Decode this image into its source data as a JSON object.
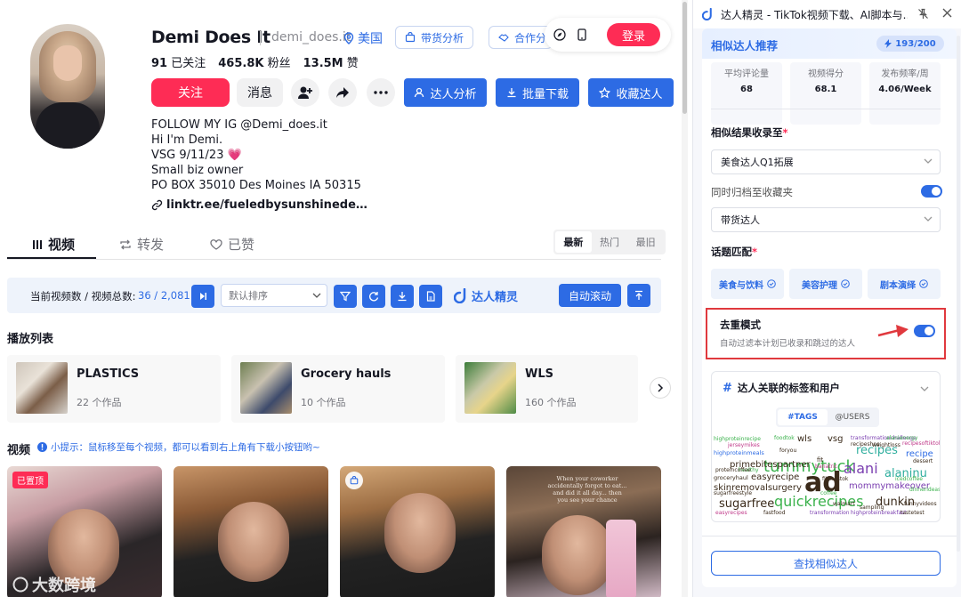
{
  "profile": {
    "name": "Demi Does It",
    "handle": "demi_does.it",
    "country": "美国",
    "following_count": "91",
    "following_label": "已关注",
    "followers_count": "465.8K",
    "followers_label": "粉丝",
    "likes_count": "13.5M",
    "likes_label": "赞",
    "bio_lines": [
      "FOLLOW MY IG @Demi_does.it",
      "Hi I'm Demi.",
      "VSG 9/11/23 💗",
      "Small biz owner",
      "PO BOX 35010 Des Moines IA 50315"
    ],
    "link": "linktr.ee/fueledbysunshinede…"
  },
  "header_actions": {
    "sales_analysis": "带货分析",
    "cooperation": "合作分",
    "login": "登录"
  },
  "actions": {
    "follow": "关注",
    "message": "消息",
    "creator_analysis": "达人分析",
    "batch_download": "批量下载",
    "favorite_creator": "收藏达人"
  },
  "tabs": [
    {
      "label": "视频"
    },
    {
      "label": "转发"
    },
    {
      "label": "已赞"
    }
  ],
  "sort_options": [
    "最新",
    "热门",
    "最旧"
  ],
  "toolbar": {
    "count_label": "当前视频数 / 视频总数:",
    "count_value": "36 / 2,081",
    "sort_select": "默认排序",
    "brand": "达人精灵",
    "auto_scroll": "自动滚动"
  },
  "playlists": {
    "title": "播放列表",
    "items": [
      {
        "title": "PLASTICS",
        "count": "22 个作品"
      },
      {
        "title": "Grocery hauls",
        "count": "10 个作品"
      },
      {
        "title": "WLS",
        "count": "160 个作品"
      }
    ]
  },
  "videos": {
    "title": "视频",
    "tip": "小提示：鼠标移至每个视频，都可以看到右上角有下载小按钮哟~",
    "pinned_badge": "已置顶",
    "watermark": "大数跨境",
    "overlay_text": "When your coworker accidentally forgot to eat... and did it all day... then you see your chance"
  },
  "panel": {
    "header_title": "达人精灵 - TikTok视频下载、AI脚本与…",
    "title": "相似达人推荐",
    "quota": "193/200",
    "metrics": [
      {
        "label": "平均评论量",
        "value": "68"
      },
      {
        "label": "视频得分",
        "value": "68.1"
      },
      {
        "label": "发布频率/周",
        "value": "4.06/Week"
      }
    ],
    "collect_label": "相似结果收录至",
    "collect_value": "美食达人Q1拓展",
    "archive_label": "同时归档至收藏夹",
    "archive_value": "带货达人",
    "topic_label": "话题匹配",
    "topics": [
      "美食与饮料",
      "美容护理",
      "剧本演绎"
    ],
    "dedup_title": "去重模式",
    "dedup_desc": "自动过滤本计划已收录和跳过的达人",
    "tags_title": "达人关联的标签和用户",
    "tags_tabs": [
      "#TAGS",
      "@USERS"
    ],
    "find_button": "查找相似达人",
    "required_mark": "*",
    "wordcloud": [
      {
        "t": "tummytuck",
        "c": "#3bb24c"
      },
      {
        "t": "ad",
        "c": "#3a2a1a"
      },
      {
        "t": "alani",
        "c": "#7a3eb0"
      },
      {
        "t": "recipes",
        "c": "#2fae9e"
      },
      {
        "t": "alaninu",
        "c": "#2fae9e"
      },
      {
        "t": "quickrecipes",
        "c": "#3bb24c"
      },
      {
        "t": "sugarfree",
        "c": "#3a2a1a"
      },
      {
        "t": "dunkin",
        "c": "#3a2a1a"
      },
      {
        "t": "primebitespartner",
        "c": "#3a2a1a"
      },
      {
        "t": "skinremovalsurgery",
        "c": "#3a2a1a"
      },
      {
        "t": "mommymakeover",
        "c": "#7a3eb0"
      },
      {
        "t": "easyrecipe",
        "c": "#3a2a1a"
      },
      {
        "t": "wls",
        "c": "#3a2a1a"
      },
      {
        "t": "vsg",
        "c": "#3a2a1a"
      },
      {
        "t": "recipe",
        "c": "#2d6be4"
      },
      {
        "t": "highproteinmeals",
        "c": "#2d6be4"
      },
      {
        "t": "fit",
        "c": "#3a2a1a"
      },
      {
        "t": "groceryhaul",
        "c": "#3a2a1a"
      },
      {
        "t": "highproteinrecipe",
        "c": "#3bb24c"
      },
      {
        "t": "transformationchallenge",
        "c": "#7a3eb0"
      },
      {
        "t": "foodtok",
        "c": "#3bb24c"
      },
      {
        "t": "bariatric",
        "c": "#c03a8a"
      },
      {
        "t": "fastfood",
        "c": "#3a2a1a"
      },
      {
        "t": "coffee",
        "c": "#3bb24c"
      },
      {
        "t": "transformation",
        "c": "#7a3eb0"
      },
      {
        "t": "easyrecipes",
        "c": "#c03a8a"
      },
      {
        "t": "highproteinbreakfast",
        "c": "#7a3eb0"
      },
      {
        "t": "tastetest",
        "c": "#3a2a1a"
      },
      {
        "t": "jerseymikes",
        "c": "#c03a8a"
      },
      {
        "t": "recipeshoe",
        "c": "#3a2a1a"
      },
      {
        "t": "recipesoftiktok",
        "c": "#c03a8a"
      },
      {
        "t": "dessert",
        "c": "#3a2a1a"
      },
      {
        "t": "fitnesstok",
        "c": "#3a2a1a"
      },
      {
        "t": "icedcoffee",
        "c": "#3bb24c"
      },
      {
        "t": "sugarfreestyle",
        "c": "#3a2a1a"
      },
      {
        "t": "walmart",
        "c": "#3a2a1a"
      },
      {
        "t": "weightloss",
        "c": "#3a2a1a"
      },
      {
        "t": "dinnerideas",
        "c": "#3bb24c"
      },
      {
        "t": "foryou",
        "c": "#3a2a1a"
      },
      {
        "t": "funnyvideos",
        "c": "#3a2a1a"
      },
      {
        "t": "healthy",
        "c": "#3bb24c"
      },
      {
        "t": "sampling",
        "c": "#3a2a1a"
      },
      {
        "t": "alanienergy",
        "c": "#3bb24c"
      },
      {
        "t": "proteincoffee",
        "c": "#3a2a1a"
      }
    ]
  },
  "colors": {
    "accent": "#2d6be4",
    "brand_red": "#fe2c55"
  }
}
